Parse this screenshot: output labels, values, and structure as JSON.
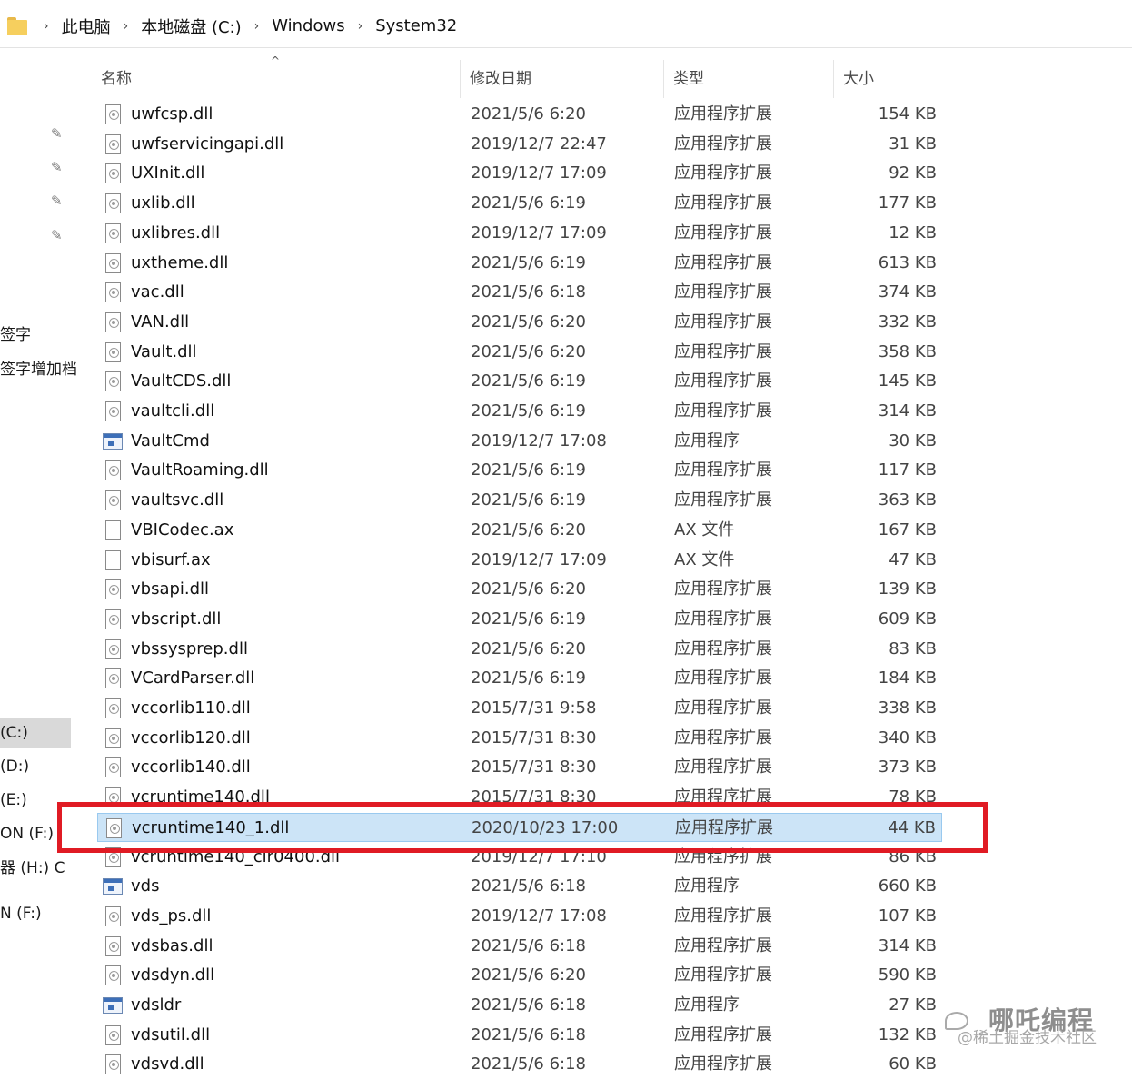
{
  "address_bar": {
    "crumbs": [
      "此电脑",
      "本地磁盘 (C:)",
      "Windows",
      "System32"
    ],
    "separator": "›"
  },
  "nav_pane": {
    "pin_icon": "pin-icon",
    "items": [
      "签字",
      "签字增加档",
      "(C:)",
      "(D:)",
      "(E:)",
      "ON (F:)",
      "器 (H:) C",
      "N (F:)"
    ],
    "selected_index": 2
  },
  "columns": {
    "name": "名称",
    "date": "修改日期",
    "type": "类型",
    "size": "大小",
    "sort_indicator": "^"
  },
  "files": [
    {
      "name": "uwfcsp.dll",
      "date": "2021/5/6 6:20",
      "type": "应用程序扩展",
      "size": "154 KB",
      "icon": "dll"
    },
    {
      "name": "uwfservicingapi.dll",
      "date": "2019/12/7 22:47",
      "type": "应用程序扩展",
      "size": "31 KB",
      "icon": "dll"
    },
    {
      "name": "UXInit.dll",
      "date": "2019/12/7 17:09",
      "type": "应用程序扩展",
      "size": "92 KB",
      "icon": "dll"
    },
    {
      "name": "uxlib.dll",
      "date": "2021/5/6 6:19",
      "type": "应用程序扩展",
      "size": "177 KB",
      "icon": "dll"
    },
    {
      "name": "uxlibres.dll",
      "date": "2019/12/7 17:09",
      "type": "应用程序扩展",
      "size": "12 KB",
      "icon": "dll"
    },
    {
      "name": "uxtheme.dll",
      "date": "2021/5/6 6:19",
      "type": "应用程序扩展",
      "size": "613 KB",
      "icon": "dll"
    },
    {
      "name": "vac.dll",
      "date": "2021/5/6 6:18",
      "type": "应用程序扩展",
      "size": "374 KB",
      "icon": "dll"
    },
    {
      "name": "VAN.dll",
      "date": "2021/5/6 6:20",
      "type": "应用程序扩展",
      "size": "332 KB",
      "icon": "dll"
    },
    {
      "name": "Vault.dll",
      "date": "2021/5/6 6:20",
      "type": "应用程序扩展",
      "size": "358 KB",
      "icon": "dll"
    },
    {
      "name": "VaultCDS.dll",
      "date": "2021/5/6 6:19",
      "type": "应用程序扩展",
      "size": "145 KB",
      "icon": "dll"
    },
    {
      "name": "vaultcli.dll",
      "date": "2021/5/6 6:19",
      "type": "应用程序扩展",
      "size": "314 KB",
      "icon": "dll"
    },
    {
      "name": "VaultCmd",
      "date": "2019/12/7 17:08",
      "type": "应用程序",
      "size": "30 KB",
      "icon": "exe"
    },
    {
      "name": "VaultRoaming.dll",
      "date": "2021/5/6 6:19",
      "type": "应用程序扩展",
      "size": "117 KB",
      "icon": "dll"
    },
    {
      "name": "vaultsvc.dll",
      "date": "2021/5/6 6:19",
      "type": "应用程序扩展",
      "size": "363 KB",
      "icon": "dll"
    },
    {
      "name": "VBICodec.ax",
      "date": "2021/5/6 6:20",
      "type": "AX 文件",
      "size": "167 KB",
      "icon": "file"
    },
    {
      "name": "vbisurf.ax",
      "date": "2019/12/7 17:09",
      "type": "AX 文件",
      "size": "47 KB",
      "icon": "file"
    },
    {
      "name": "vbsapi.dll",
      "date": "2021/5/6 6:20",
      "type": "应用程序扩展",
      "size": "139 KB",
      "icon": "dll"
    },
    {
      "name": "vbscript.dll",
      "date": "2021/5/6 6:19",
      "type": "应用程序扩展",
      "size": "609 KB",
      "icon": "dll"
    },
    {
      "name": "vbssysprep.dll",
      "date": "2021/5/6 6:20",
      "type": "应用程序扩展",
      "size": "83 KB",
      "icon": "dll"
    },
    {
      "name": "VCardParser.dll",
      "date": "2021/5/6 6:19",
      "type": "应用程序扩展",
      "size": "184 KB",
      "icon": "dll"
    },
    {
      "name": "vccorlib110.dll",
      "date": "2015/7/31 9:58",
      "type": "应用程序扩展",
      "size": "338 KB",
      "icon": "dll"
    },
    {
      "name": "vccorlib120.dll",
      "date": "2015/7/31 8:30",
      "type": "应用程序扩展",
      "size": "340 KB",
      "icon": "dll"
    },
    {
      "name": "vccorlib140.dll",
      "date": "2015/7/31 8:30",
      "type": "应用程序扩展",
      "size": "373 KB",
      "icon": "dll"
    },
    {
      "name": "vcruntime140.dll",
      "date": "2015/7/31 8:30",
      "type": "应用程序扩展",
      "size": "78 KB",
      "icon": "dll"
    },
    {
      "name": "vcruntime140_1.dll",
      "date": "2020/10/23 17:00",
      "type": "应用程序扩展",
      "size": "44 KB",
      "icon": "dll",
      "selected": true
    },
    {
      "name": "vcruntime140_clr0400.dll",
      "date": "2019/12/7 17:10",
      "type": "应用程序扩展",
      "size": "86 KB",
      "icon": "dll"
    },
    {
      "name": "vds",
      "date": "2021/5/6 6:18",
      "type": "应用程序",
      "size": "660 KB",
      "icon": "exe"
    },
    {
      "name": "vds_ps.dll",
      "date": "2019/12/7 17:08",
      "type": "应用程序扩展",
      "size": "107 KB",
      "icon": "dll"
    },
    {
      "name": "vdsbas.dll",
      "date": "2021/5/6 6:18",
      "type": "应用程序扩展",
      "size": "314 KB",
      "icon": "dll"
    },
    {
      "name": "vdsdyn.dll",
      "date": "2021/5/6 6:20",
      "type": "应用程序扩展",
      "size": "590 KB",
      "icon": "dll"
    },
    {
      "name": "vdsldr",
      "date": "2021/5/6 6:18",
      "type": "应用程序",
      "size": "27 KB",
      "icon": "exe"
    },
    {
      "name": "vdsutil.dll",
      "date": "2021/5/6 6:18",
      "type": "应用程序扩展",
      "size": "132 KB",
      "icon": "dll"
    },
    {
      "name": "vdsvd.dll",
      "date": "2021/5/6 6:18",
      "type": "应用程序扩展",
      "size": "60 KB",
      "icon": "dll"
    }
  ],
  "watermark": {
    "title": "哪吒编程",
    "subtitle": "@稀土掘金技术社区"
  },
  "colors": {
    "selection_bg": "#cce4f7",
    "selection_border": "#99c9ef",
    "highlight": "#e01b24"
  }
}
